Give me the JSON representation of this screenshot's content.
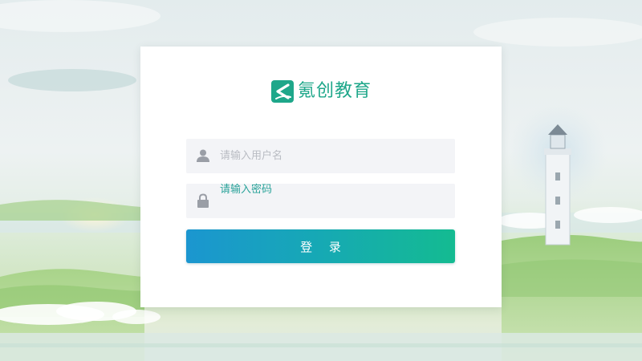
{
  "brand": {
    "name": "氪创教育",
    "logo_icon": "brand-logo-icon",
    "color": "#1ea78a"
  },
  "form": {
    "username": {
      "placeholder": "请输入用户名",
      "value": "",
      "icon": "user-icon"
    },
    "password": {
      "placeholder": "请输入密码",
      "value": "",
      "icon": "lock-icon"
    },
    "submit_label": "登 录"
  },
  "theme": {
    "button_gradient_start": "#1b96d0",
    "button_gradient_end": "#14bb91",
    "field_background": "#f3f4f7",
    "placeholder_color": "#b9bcc3"
  }
}
